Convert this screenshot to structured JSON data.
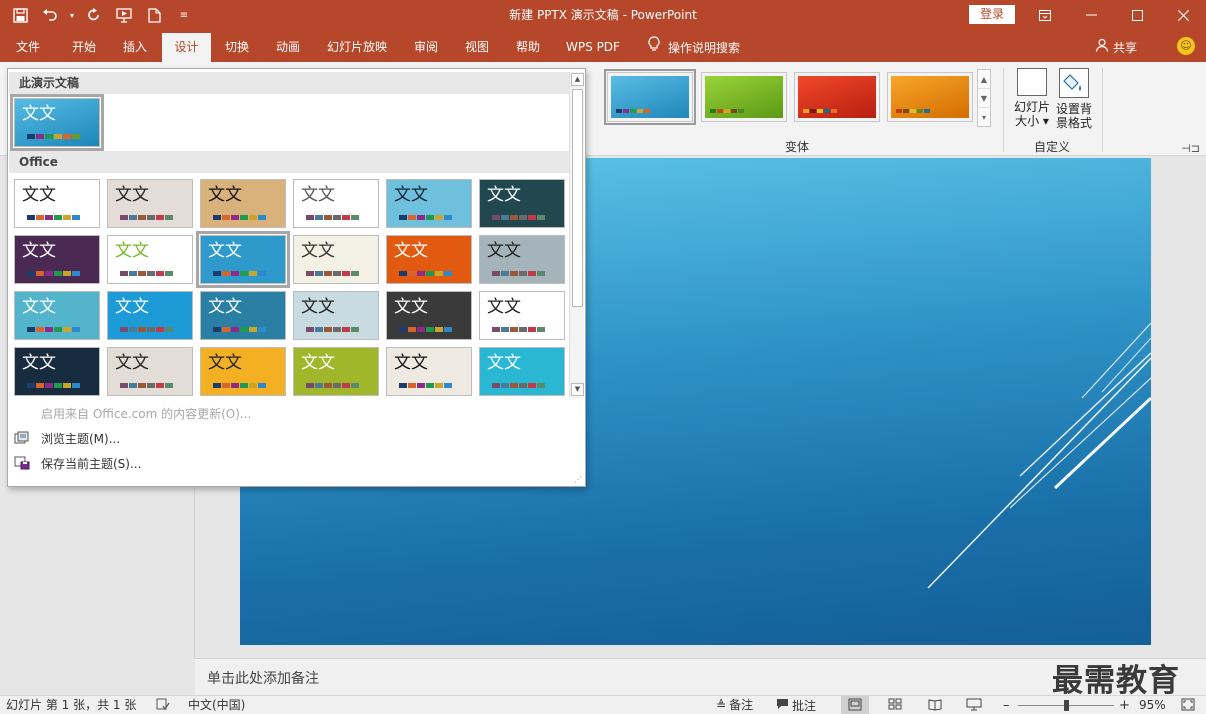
{
  "window": {
    "title": "新建 PPTX 演示文稿  -  PowerPoint",
    "login": "登录"
  },
  "qat": [
    "save-icon",
    "undo-icon",
    "redo-icon",
    "start-from-beginning-icon",
    "new-icon",
    "customize-icon"
  ],
  "tabs": [
    {
      "label": "文件"
    },
    {
      "label": "开始"
    },
    {
      "label": "插入"
    },
    {
      "label": "设计"
    },
    {
      "label": "切换"
    },
    {
      "label": "动画"
    },
    {
      "label": "幻灯片放映"
    },
    {
      "label": "审阅"
    },
    {
      "label": "视图"
    },
    {
      "label": "帮助"
    },
    {
      "label": "WPS PDF"
    }
  ],
  "tell_me": "操作说明搜索",
  "share": "共享",
  "ribbon": {
    "variants_label": "变体",
    "customize_label": "自定义",
    "slide_size_line1": "幻灯片",
    "slide_size_line2": "大小",
    "bg_format_line1": "设置背",
    "bg_format_line2": "景格式",
    "variants": [
      {
        "bg": "#2ea1cf",
        "accent": "#1b6fa1"
      },
      {
        "bg": "#7ab829",
        "accent": "#5a9a14"
      },
      {
        "bg": "#e0301e",
        "accent": "#b81e10"
      },
      {
        "bg": "#f08a15",
        "accent": "#d46d00"
      }
    ]
  },
  "dropdown": {
    "this_presentation": "此演示文稿",
    "office": "Office",
    "theme_glyph": "文文",
    "current_theme": {
      "bg": "#2d9acb"
    },
    "themes": [
      {
        "bg": "#ffffff",
        "text": "#222"
      },
      {
        "bg": "#e4dcd6",
        "text": "#222"
      },
      {
        "bg": "#d8b27a",
        "text": "#111"
      },
      {
        "bg": "#ffffff",
        "text": "#555"
      },
      {
        "bg": "#6fc0dd",
        "text": "#123"
      },
      {
        "bg": "#21474f",
        "text": "#fff"
      },
      {
        "bg": "#4a2a53",
        "text": "#fff"
      },
      {
        "bg": "#ffffff",
        "text": "#7ab829"
      },
      {
        "bg": "#2d9acb",
        "text": "#fff"
      },
      {
        "bg": "#f3f1e4",
        "text": "#333"
      },
      {
        "bg": "#e25a0f",
        "text": "#fff"
      },
      {
        "bg": "#a5b3ba",
        "text": "#222"
      },
      {
        "bg": "#53b5cc",
        "text": "#fff"
      },
      {
        "bg": "#1d9bd6",
        "text": "#fff"
      },
      {
        "bg": "#2a7fa4",
        "text": "#fff"
      },
      {
        "bg": "#c8dbe0",
        "text": "#222"
      },
      {
        "bg": "#3a3a3a",
        "text": "#fff"
      },
      {
        "bg": "#ffffff",
        "text": "#222"
      },
      {
        "bg": "#172c3f",
        "text": "#fff"
      },
      {
        "bg": "#e2ded7",
        "text": "#222"
      },
      {
        "bg": "#f2b022",
        "text": "#222"
      },
      {
        "bg": "#a0b62b",
        "text": "#fff"
      },
      {
        "bg": "#eeeae1",
        "text": "#111"
      },
      {
        "bg": "#29b7d4",
        "text": "#fff"
      }
    ],
    "menu": [
      {
        "label": "启用来自 Office.com 的内容更新(O)...",
        "enabled": false
      },
      {
        "label": "浏览主题(M)...",
        "enabled": true
      },
      {
        "label": "保存当前主题(S)...",
        "enabled": true
      }
    ]
  },
  "notes_placeholder": "单击此处添加备注",
  "watermark": "最需教育",
  "status": {
    "slide_info": "幻灯片 第 1 张，共 1 张",
    "language": "中文(中国)",
    "notes": "备注",
    "comments": "批注",
    "zoom": "95%",
    "zoom_level": 0.5
  }
}
